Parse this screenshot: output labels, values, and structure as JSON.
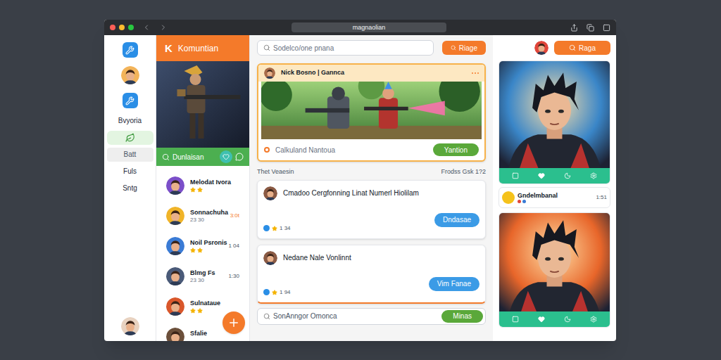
{
  "browser": {
    "address": "magnaolian"
  },
  "sidebar": {
    "items": [
      {
        "kind": "tool",
        "selected": false,
        "hovered": false
      },
      {
        "kind": "avatar",
        "selected": false,
        "hovered": false
      },
      {
        "kind": "tool",
        "selected": false,
        "hovered": false
      },
      {
        "kind": "label",
        "label": "Bvyoria",
        "selected": false,
        "hovered": false
      },
      {
        "kind": "leaf",
        "selected": true,
        "hovered": false
      },
      {
        "kind": "label",
        "label": "Batt",
        "selected": false,
        "hovered": true
      },
      {
        "kind": "label",
        "label": "Fuls",
        "selected": false,
        "hovered": false
      },
      {
        "kind": "label",
        "label": "Sntg",
        "selected": false,
        "hovered": false
      }
    ]
  },
  "brand": {
    "letter": "K",
    "name": "Komuntian"
  },
  "feature": {
    "label": "Dunlaisan"
  },
  "contacts": [
    {
      "name": "Melodat Ivora",
      "stars": 2,
      "meta": "",
      "time": "",
      "unread": false
    },
    {
      "name": "Sonnachuha",
      "stars": 0,
      "meta": "23 30",
      "time": "3:0t",
      "unread": true
    },
    {
      "name": "Noil Psronis",
      "stars": 2,
      "meta": "",
      "time": "1 04",
      "unread": false
    },
    {
      "name": "Blmg Fs",
      "stars": 0,
      "meta": "23 30",
      "time": "1:30",
      "unread": false
    },
    {
      "name": "Sulnataue",
      "stars": 2,
      "meta": "",
      "time": "",
      "unread": false
    },
    {
      "name": "Sfalie",
      "stars": 0,
      "meta": "",
      "time": "",
      "unread": false
    }
  ],
  "search": {
    "placeholder": "Sodelco/one pnana",
    "button": "Riage"
  },
  "header_button": "Raga",
  "post": {
    "title": "Nick Bosno | Gannca",
    "comment_placeholder": "Calkuland Nantoua",
    "button": "Yantion"
  },
  "thread": {
    "title": "Thet Veaesin",
    "meta": "Frodss Gsk 1?2"
  },
  "messages": [
    {
      "text": "Cmadoo Cergfonning Linat Numerl Hiolilam",
      "button": "Dndasae",
      "count": "1 34"
    },
    {
      "text": "Nedane Nale Vonlinnt",
      "button": "Vim Fanae",
      "count": "1 94"
    }
  ],
  "composer": {
    "placeholder": "SonAnngor Omonca",
    "button": "Minas"
  },
  "right_panel": {
    "cards": [
      {
        "color": "#3a86c8"
      },
      {
        "color": "#e8662a"
      }
    ],
    "row": {
      "name": "Gndelmbanal",
      "time": "1:51"
    }
  }
}
